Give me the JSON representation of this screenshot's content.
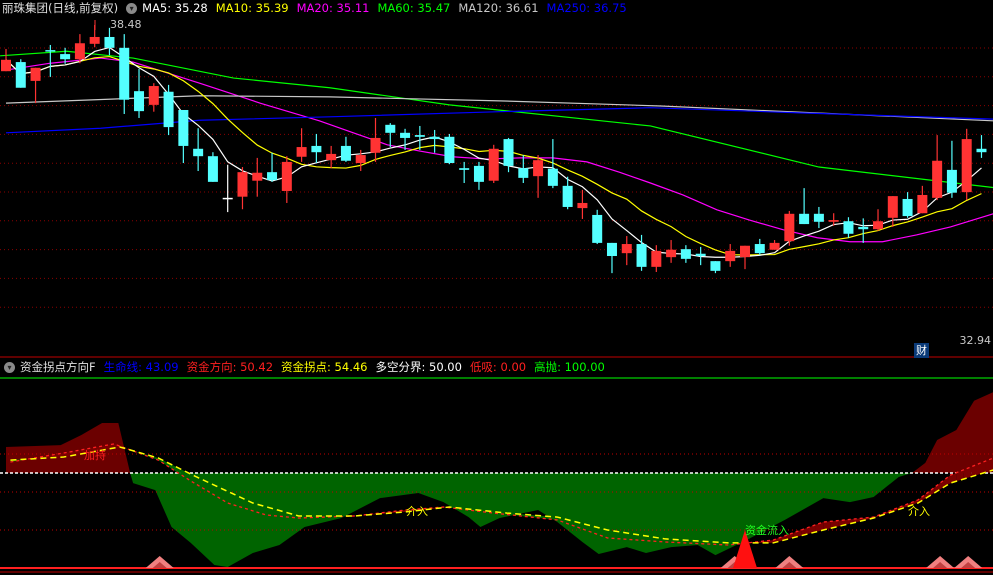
{
  "main_header": {
    "title": "丽珠集团(日线,前复权)",
    "ma": [
      {
        "label": "MA5: 35.28",
        "color": "#ffffff"
      },
      {
        "label": "MA10: 35.39",
        "color": "#ffff00"
      },
      {
        "label": "MA20: 35.11",
        "color": "#ff00ff"
      },
      {
        "label": "MA60: 35.47",
        "color": "#00ff00"
      },
      {
        "label": "MA120: 36.61",
        "color": "#c8c8c8"
      },
      {
        "label": "MA250: 36.75",
        "color": "#0000ff"
      }
    ]
  },
  "high_marker": "38.48",
  "low_axis_label": "32.94",
  "finance_badge": "财",
  "indicator_header": {
    "title": "资金拐点方向F",
    "items": [
      {
        "label": "生命线: 43.09",
        "color": "#0000ff"
      },
      {
        "label": "资金方向: 50.42",
        "color": "#ff2020"
      },
      {
        "label": "资金拐点: 54.46",
        "color": "#ffff00"
      },
      {
        "label": "多空分界: 50.00",
        "color": "#ffffff"
      },
      {
        "label": "低吸: 0.00",
        "color": "#ff2020"
      },
      {
        "label": "高抛: 100.00",
        "color": "#00ff00"
      }
    ]
  },
  "signals": {
    "hold": "加持",
    "enter1": "介入",
    "enter2": "介入",
    "inflow": "资金流入"
  },
  "colors": {
    "up": "#ff3333",
    "down": "#54ffff",
    "doji": "#ffffff",
    "grid": "#8b0000"
  },
  "chart_data": {
    "type": "candlestick",
    "price_range": [
      32.94,
      38.48
    ],
    "candles": [
      [
        37.67,
        38.06,
        37.67,
        37.87
      ],
      [
        37.83,
        37.88,
        37.38,
        37.38
      ],
      [
        37.5,
        37.73,
        37.11,
        37.73
      ],
      [
        38.02,
        38.13,
        37.57,
        38.04
      ],
      [
        37.97,
        38.08,
        37.8,
        37.88
      ],
      [
        37.88,
        38.32,
        37.81,
        38.16
      ],
      [
        38.15,
        38.48,
        38.09,
        38.27
      ],
      [
        38.27,
        38.43,
        37.95,
        38.08
      ],
      [
        38.08,
        38.32,
        36.92,
        37.17
      ],
      [
        37.32,
        37.71,
        36.85,
        36.97
      ],
      [
        37.08,
        37.46,
        36.96,
        37.41
      ],
      [
        37.31,
        37.43,
        36.55,
        36.69
      ],
      [
        36.99,
        36.99,
        36.06,
        36.36
      ],
      [
        36.31,
        36.67,
        35.92,
        36.18
      ],
      [
        36.18,
        36.25,
        35.73,
        35.73
      ],
      [
        35.45,
        36.03,
        35.2,
        35.45
      ],
      [
        35.47,
        35.99,
        35.25,
        35.9
      ],
      [
        35.75,
        36.15,
        35.47,
        35.89
      ],
      [
        35.9,
        36.24,
        35.73,
        35.76
      ],
      [
        35.57,
        36.18,
        35.36,
        36.08
      ],
      [
        36.17,
        36.67,
        36.08,
        36.34
      ],
      [
        36.36,
        36.57,
        36.06,
        36.25
      ],
      [
        36.11,
        36.36,
        35.97,
        36.22
      ],
      [
        36.36,
        36.52,
        36.08,
        36.1
      ],
      [
        36.06,
        36.29,
        35.92,
        36.2
      ],
      [
        36.24,
        36.85,
        36.08,
        36.5
      ],
      [
        36.73,
        36.76,
        36.34,
        36.59
      ],
      [
        36.59,
        36.66,
        36.29,
        36.5
      ],
      [
        36.55,
        36.71,
        36.29,
        36.52
      ],
      [
        36.52,
        36.64,
        36.24,
        36.48
      ],
      [
        36.52,
        36.57,
        36.04,
        36.06
      ],
      [
        35.97,
        36.08,
        35.71,
        35.94
      ],
      [
        36.01,
        36.08,
        35.59,
        35.73
      ],
      [
        35.75,
        36.38,
        35.71,
        36.31
      ],
      [
        36.48,
        36.5,
        35.9,
        36.01
      ],
      [
        35.97,
        36.2,
        35.71,
        35.8
      ],
      [
        35.83,
        36.2,
        35.45,
        36.11
      ],
      [
        35.96,
        36.48,
        35.62,
        35.66
      ],
      [
        35.66,
        35.82,
        35.25,
        35.29
      ],
      [
        35.27,
        35.59,
        35.08,
        35.36
      ],
      [
        35.15,
        35.24,
        34.64,
        34.66
      ],
      [
        34.66,
        34.66,
        34.13,
        34.43
      ],
      [
        34.48,
        34.78,
        34.27,
        34.64
      ],
      [
        34.64,
        34.8,
        34.17,
        34.24
      ],
      [
        34.24,
        34.62,
        34.15,
        34.52
      ],
      [
        34.41,
        34.71,
        34.31,
        34.54
      ],
      [
        34.55,
        34.62,
        34.31,
        34.38
      ],
      [
        34.47,
        34.59,
        34.27,
        34.43
      ],
      [
        34.34,
        34.34,
        34.13,
        34.17
      ],
      [
        34.34,
        34.64,
        34.24,
        34.52
      ],
      [
        34.41,
        34.61,
        34.2,
        34.61
      ],
      [
        34.64,
        34.73,
        34.45,
        34.48
      ],
      [
        34.54,
        34.71,
        34.54,
        34.66
      ],
      [
        34.69,
        35.22,
        34.61,
        35.17
      ],
      [
        35.17,
        35.62,
        34.99,
        34.99
      ],
      [
        35.17,
        35.29,
        34.92,
        35.03
      ],
      [
        35.03,
        35.18,
        34.96,
        35.06
      ],
      [
        35.04,
        35.11,
        34.75,
        34.82
      ],
      [
        34.94,
        35.09,
        34.66,
        34.9
      ],
      [
        34.9,
        35.25,
        34.87,
        35.04
      ],
      [
        35.1,
        35.48,
        34.94,
        35.48
      ],
      [
        35.43,
        35.55,
        35.1,
        35.13
      ],
      [
        35.18,
        35.66,
        35.18,
        35.5
      ],
      [
        35.45,
        36.55,
        35.41,
        36.1
      ],
      [
        35.94,
        36.45,
        35.45,
        35.54
      ],
      [
        35.55,
        36.66,
        35.41,
        36.48
      ],
      [
        36.31,
        36.55,
        36.15,
        36.25
      ]
    ],
    "ma_lines": {
      "MA20": [
        [
          0,
          37.69
        ],
        [
          3,
          37.81
        ],
        [
          6.4,
          37.9
        ],
        [
          8.6,
          37.83
        ],
        [
          13.1,
          37.46
        ],
        [
          17.2,
          37.11
        ],
        [
          21.2,
          36.8
        ],
        [
          23.5,
          36.59
        ],
        [
          25.8,
          36.38
        ],
        [
          28,
          36.27
        ],
        [
          30.2,
          36.17
        ],
        [
          32.5,
          36.13
        ],
        [
          34.8,
          36.15
        ],
        [
          37,
          36.15
        ],
        [
          39.3,
          36.08
        ],
        [
          41.5,
          35.9
        ],
        [
          43.6,
          35.71
        ],
        [
          45.8,
          35.5
        ],
        [
          48.1,
          35.24
        ],
        [
          50.3,
          35.06
        ],
        [
          52.6,
          34.89
        ],
        [
          54.9,
          34.75
        ],
        [
          57.1,
          34.68
        ],
        [
          59.3,
          34.68
        ],
        [
          61.6,
          34.8
        ],
        [
          63.9,
          34.94
        ],
        [
          66.8,
          35.17
        ]
      ],
      "MA60": [
        [
          -0.4,
          37.94
        ],
        [
          4.1,
          38.02
        ],
        [
          8.6,
          37.9
        ],
        [
          15.4,
          37.55
        ],
        [
          21.9,
          37.38
        ],
        [
          30,
          37.08
        ],
        [
          43.6,
          36.71
        ],
        [
          55,
          35.99
        ],
        [
          66.8,
          35.63
        ]
      ],
      "MA120": [
        [
          0,
          37.11
        ],
        [
          13.1,
          37.24
        ],
        [
          21.9,
          37.22
        ],
        [
          33.4,
          37.15
        ],
        [
          44.3,
          37.06
        ],
        [
          66.8,
          36.8
        ]
      ],
      "MA250": [
        [
          0,
          36.59
        ],
        [
          6.4,
          36.67
        ],
        [
          13.1,
          36.81
        ],
        [
          21.9,
          36.87
        ],
        [
          33.4,
          36.96
        ],
        [
          43.6,
          37.03
        ],
        [
          53.7,
          36.94
        ],
        [
          66.8,
          36.83
        ]
      ]
    },
    "indicator": {
      "range": [
        0,
        100
      ],
      "levels": [
        20,
        40,
        60
      ],
      "divider": 50,
      "life_line": [
        [
          0,
          63.7
        ],
        [
          3.7,
          64.7
        ],
        [
          5.1,
          70
        ],
        [
          6.5,
          76.3
        ],
        [
          7.6,
          76.3
        ],
        [
          8.4,
          50
        ],
        [
          8.6,
          44.7
        ],
        [
          10.1,
          41
        ],
        [
          11.2,
          21.6
        ],
        [
          12.5,
          13.2
        ],
        [
          14.1,
          1.6
        ],
        [
          15,
          0.5
        ],
        [
          16.7,
          7.9
        ],
        [
          18.5,
          12.1
        ],
        [
          20.2,
          21.6
        ],
        [
          22.7,
          26.3
        ],
        [
          25.3,
          36.8
        ],
        [
          27.9,
          39.5
        ],
        [
          29.6,
          34.7
        ],
        [
          31.3,
          26.8
        ],
        [
          32.1,
          21.6
        ],
        [
          33.4,
          26.3
        ],
        [
          36,
          30.5
        ],
        [
          37.3,
          24.2
        ],
        [
          39,
          13.7
        ],
        [
          40.1,
          7.4
        ],
        [
          42,
          11
        ],
        [
          43.3,
          7.9
        ],
        [
          45,
          11
        ],
        [
          46.8,
          12.1
        ],
        [
          48,
          6.8
        ],
        [
          50.1,
          14.7
        ],
        [
          52.7,
          25.3
        ],
        [
          55.3,
          36.8
        ],
        [
          57.1,
          34.7
        ],
        [
          58.7,
          37.4
        ],
        [
          60.4,
          47.9
        ],
        [
          61.3,
          50
        ],
        [
          62.2,
          55.3
        ],
        [
          63,
          67.4
        ],
        [
          64.3,
          72.6
        ],
        [
          65.5,
          88
        ],
        [
          66.8,
          92.6
        ]
      ],
      "turning_point": [
        [
          0.3,
          56.8
        ],
        [
          3.9,
          58.4
        ],
        [
          7.7,
          63.7
        ],
        [
          10.3,
          57.9
        ],
        [
          12.9,
          47.9
        ],
        [
          16.7,
          34.2
        ],
        [
          19.8,
          27.4
        ],
        [
          23.6,
          27.4
        ],
        [
          27,
          29.5
        ],
        [
          30,
          32.1
        ],
        [
          33.9,
          28.9
        ],
        [
          37.3,
          26.8
        ],
        [
          40.7,
          20
        ],
        [
          44.6,
          15.3
        ],
        [
          48.9,
          13.2
        ],
        [
          51.9,
          13.2
        ],
        [
          55.3,
          20
        ],
        [
          58.7,
          26.3
        ],
        [
          61.7,
          34.2
        ],
        [
          63.9,
          44.7
        ],
        [
          66.8,
          51.6
        ]
      ],
      "direction": [
        [
          0.3,
          55.8
        ],
        [
          3.9,
          60.5
        ],
        [
          7.3,
          65.3
        ],
        [
          10.3,
          56.8
        ],
        [
          12.4,
          46.3
        ],
        [
          15,
          34.2
        ],
        [
          17.6,
          27.9
        ],
        [
          19.8,
          26.3
        ],
        [
          23.6,
          27.4
        ],
        [
          27,
          30.5
        ],
        [
          29.6,
          32.1
        ],
        [
          33,
          28.9
        ],
        [
          37.3,
          25.3
        ],
        [
          40.7,
          15.8
        ],
        [
          44.6,
          13.7
        ],
        [
          48.9,
          12.1
        ],
        [
          51.9,
          14.7
        ],
        [
          55.3,
          24.2
        ],
        [
          58.7,
          26.8
        ],
        [
          61.7,
          35.8
        ],
        [
          63.9,
          48.9
        ],
        [
          66.8,
          57.9
        ]
      ],
      "low_buy_markers": [
        10.4,
        49.3,
        53,
        63.2,
        65.1
      ],
      "inflow_spike": {
        "bar": 50,
        "value": 20
      }
    }
  }
}
